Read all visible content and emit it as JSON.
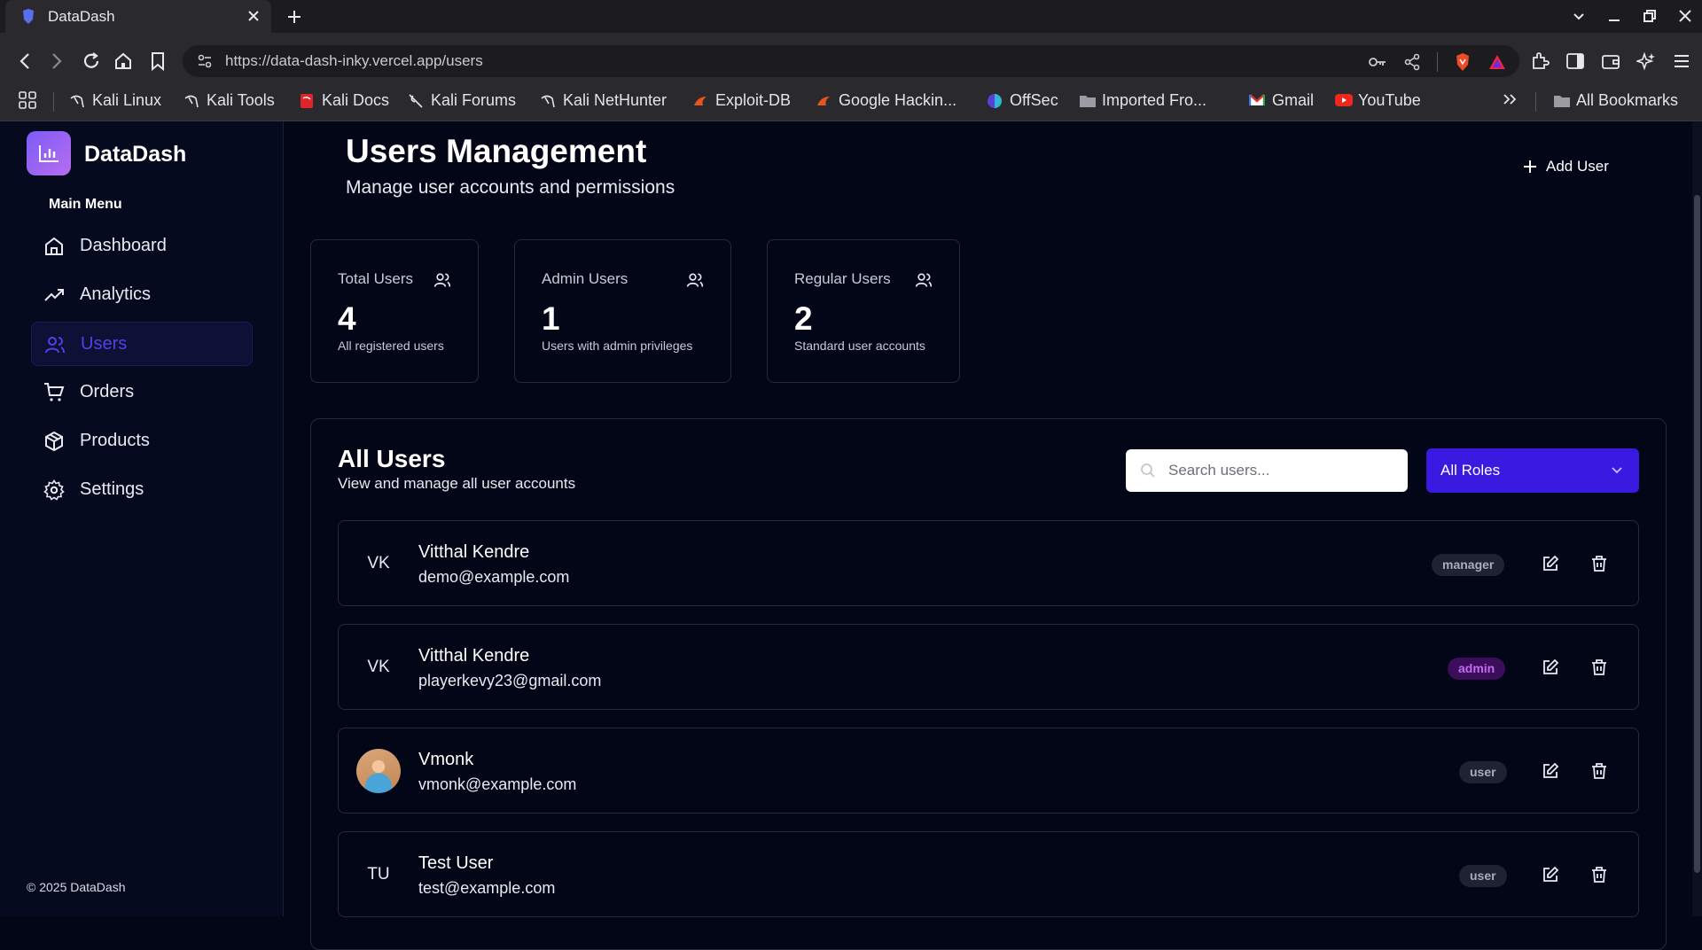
{
  "browser": {
    "tab_title": "DataDash",
    "url": "https://data-dash-inky.vercel.app/users",
    "bookmarks": [
      {
        "label": "Kali Linux",
        "icon": "kali-icon"
      },
      {
        "label": "Kali Tools",
        "icon": "kali-icon"
      },
      {
        "label": "Kali Docs",
        "icon": "kali-docs-icon"
      },
      {
        "label": "Kali Forums",
        "icon": "kali-icon"
      },
      {
        "label": "Kali NetHunter",
        "icon": "kali-icon"
      },
      {
        "label": "Exploit-DB",
        "icon": "exploitdb-icon"
      },
      {
        "label": "Google Hackin...",
        "icon": "exploitdb-icon"
      },
      {
        "label": "OffSec",
        "icon": "offsec-icon"
      },
      {
        "label": "Imported Fro...",
        "icon": "folder-icon"
      },
      {
        "label": "Gmail",
        "icon": "gmail-icon"
      },
      {
        "label": "YouTube",
        "icon": "youtube-icon"
      }
    ],
    "all_bookmarks_label": "All Bookmarks"
  },
  "sidebar": {
    "brand": "DataDash",
    "menu_heading": "Main Menu",
    "items": [
      {
        "label": "Dashboard",
        "icon": "home-icon"
      },
      {
        "label": "Analytics",
        "icon": "trend-icon"
      },
      {
        "label": "Users",
        "icon": "users-icon",
        "active": true
      },
      {
        "label": "Orders",
        "icon": "cart-icon"
      },
      {
        "label": "Products",
        "icon": "box-icon"
      },
      {
        "label": "Settings",
        "icon": "gear-icon"
      }
    ],
    "copyright": "© 2025 DataDash"
  },
  "header": {
    "title": "Users Management",
    "subtitle": "Manage user accounts and permissions",
    "add_user_label": "Add User"
  },
  "stats": [
    {
      "label": "Total Users",
      "value": "4",
      "desc": "All registered users"
    },
    {
      "label": "Admin Users",
      "value": "1",
      "desc": "Users with admin privileges"
    },
    {
      "label": "Regular Users",
      "value": "2",
      "desc": "Standard user accounts"
    }
  ],
  "users_panel": {
    "title": "All Users",
    "subtitle": "View and manage all user accounts",
    "search_placeholder": "Search users...",
    "role_filter": "All Roles",
    "rows": [
      {
        "initials": "VK",
        "name": "Vitthal Kendre",
        "email": "demo@example.com",
        "role": "manager"
      },
      {
        "initials": "VK",
        "name": "Vitthal Kendre",
        "email": "playerkevy23@gmail.com",
        "role": "admin"
      },
      {
        "initials": "",
        "name": "Vmonk",
        "email": "vmonk@example.com",
        "role": "user",
        "has_photo": true
      },
      {
        "initials": "TU",
        "name": "Test User",
        "email": "test@example.com",
        "role": "user"
      }
    ]
  },
  "colors": {
    "background": "#030617",
    "accent": "#3a1ae0",
    "active_nav_text": "#4c43e8",
    "admin_badge": "#c26df0"
  }
}
